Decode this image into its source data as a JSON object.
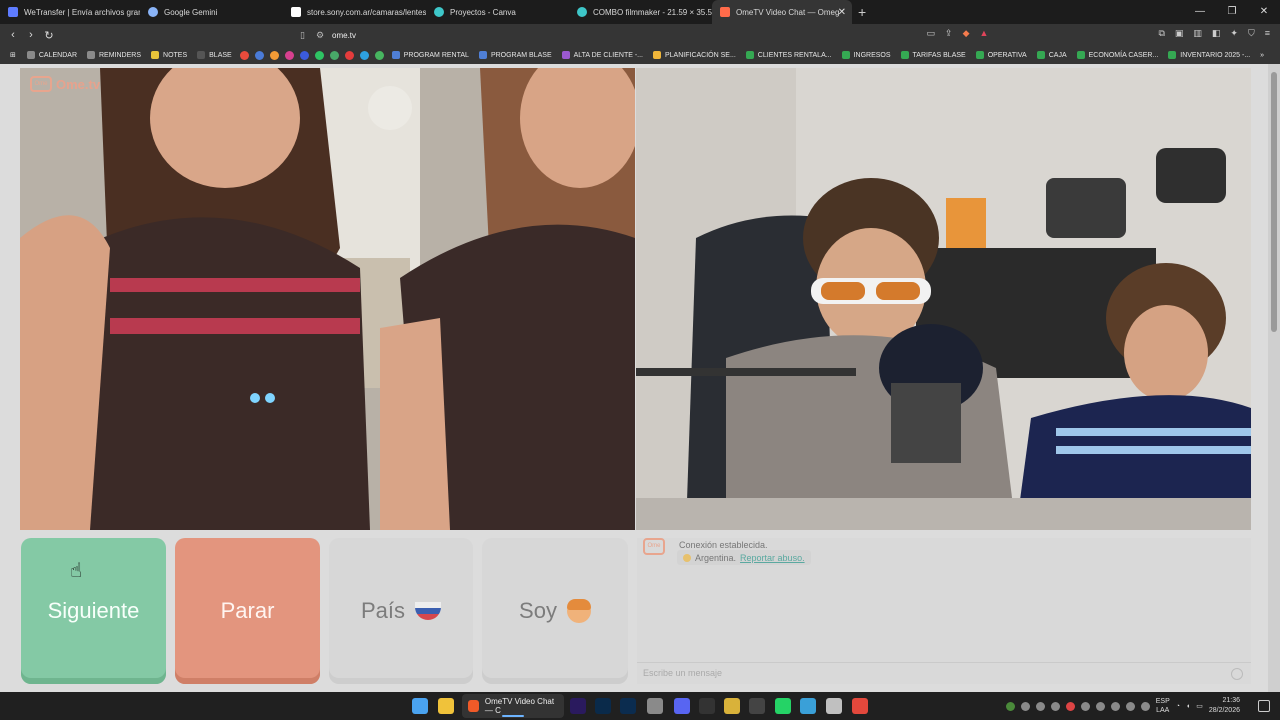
{
  "browser": {
    "tabs": [
      {
        "title": "WeTransfer | Envía archivos grandes",
        "color": "#5e7cff"
      },
      {
        "title": "Google Gemini",
        "color": "#8ab4f8"
      },
      {
        "title": "store.sony.com.ar/camaras/lentes?m",
        "color": "#ffffff"
      },
      {
        "title": "Proyectos - Canva",
        "color": "#3ec7c9"
      },
      {
        "title": "COMBO filmmaker - 21.59 × 35.56 c",
        "color": "#3ec7c9"
      },
      {
        "title": "OmeTV Video Chat — Omeg",
        "color": "#ff6b4a"
      }
    ],
    "new_tab": "+",
    "address": "ome.tv",
    "bookmarks": [
      "CALENDAR",
      "REMINDERS",
      "NOTES",
      "BLASE",
      "PROGRAM RENTAL",
      "PROGRAM BLASE",
      "ALTA DE CLIENTE -...",
      "PLANIFICACIÓN SE...",
      "CLIENTES RENTALA...",
      "INGRESOS",
      "TARIFAS BLASE",
      "OPERATIVA",
      "CAJA",
      "ECONOMÍA CASER...",
      "INVENTARIO 2025 -..."
    ]
  },
  "app": {
    "logo_text": "Ome.tv",
    "logo_mark": "Ome"
  },
  "controls": {
    "next": "Siguiente",
    "stop": "Parar",
    "country": "País",
    "soy": "Soy"
  },
  "chat": {
    "logo_mark": "Ome",
    "status": "Conexión establecida.",
    "country": "Argentina.",
    "report": "Reportar abuso.",
    "placeholder": "Escribe un mensaje"
  },
  "taskbar": {
    "active_app": "OmeTV Video Chat — C",
    "lang1": "ESP",
    "lang2": "LAA",
    "time": "21:36",
    "date": "28/2/2026"
  }
}
